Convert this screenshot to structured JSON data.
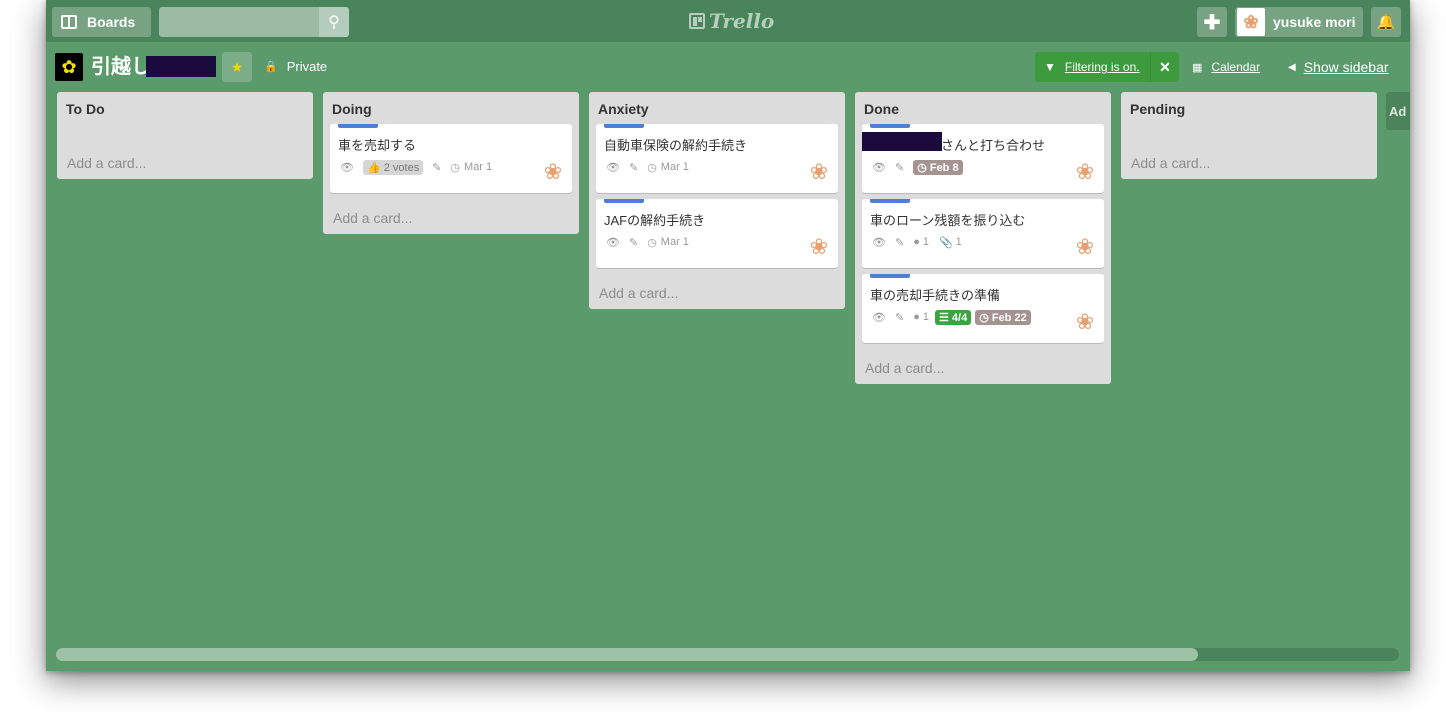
{
  "header": {
    "boards_label": "Boards",
    "search_placeholder": "",
    "logo_text": "Trello",
    "add_icon": "plus-icon",
    "user_name": "yusuke mori",
    "notif_icon": "bell-icon"
  },
  "board": {
    "title": "引越し",
    "visibility": "Private",
    "filter_label": "Filtering is on.",
    "calendar_label": "Calendar",
    "sidebar_label": "Show sidebar",
    "add_list_stub": "Ad"
  },
  "colors": {
    "board_bg": "#5b9a6b",
    "label_blue": "#4f7fd2",
    "due_badge": "#a59391",
    "checklist_done": "#3aa53c",
    "filter_on": "#3d9b3e"
  },
  "lists": [
    {
      "title": "To Do",
      "add_card": "Add a card...",
      "cards": []
    },
    {
      "title": "Doing",
      "add_card": "Add a card...",
      "cards": [
        {
          "title": "車を売却する",
          "votes": "2 votes",
          "due": "Mar 1"
        }
      ]
    },
    {
      "title": "Anxiety",
      "add_card": "Add a card...",
      "cards": [
        {
          "title": "自動車保険の解約手続き",
          "due": "Mar 1"
        },
        {
          "title": "JAFの解約手続き",
          "due": "Mar 1"
        }
      ]
    },
    {
      "title": "Done",
      "add_card": "Add a card...",
      "cards": [
        {
          "title": "さんと打ち合わせ",
          "due": "Feb 8"
        },
        {
          "title": "車のローン残額を振り込む",
          "comments": "1",
          "attachments": "1"
        },
        {
          "title": "車の売却手続きの準備",
          "comments": "1",
          "checklist": "4/4",
          "due": "Feb 22"
        }
      ]
    },
    {
      "title": "Pending",
      "add_card": "Add a card...",
      "cards": []
    }
  ],
  "scroll": {
    "fraction_visible": 0.85
  }
}
